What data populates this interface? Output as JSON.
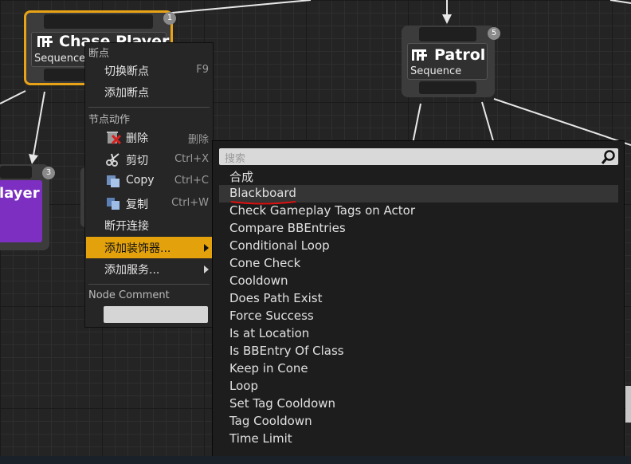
{
  "nodes": {
    "chase_player": {
      "title": "Chase Player",
      "subtitle": "Sequence",
      "index": "1"
    },
    "patrol": {
      "title": "Patrol",
      "subtitle": "Sequence",
      "index": "5"
    },
    "child_node": {
      "title": "layer",
      "index": "3"
    }
  },
  "context_menu": {
    "section_breakpoints": "断点",
    "toggle_breakpoint": {
      "label": "切换断点",
      "shortcut": "F9"
    },
    "add_breakpoint": {
      "label": "添加断点"
    },
    "section_node_actions": "节点动作",
    "delete": {
      "label": "删除",
      "shortcut": "删除",
      "icon": "delete-icon"
    },
    "cut": {
      "label": "剪切",
      "shortcut": "Ctrl+X",
      "icon": "scissors-icon"
    },
    "copy": {
      "label": "Copy",
      "shortcut": "Ctrl+C",
      "icon": "copy-icon"
    },
    "duplicate": {
      "label": "复制",
      "shortcut": "Ctrl+W",
      "icon": "duplicate-icon"
    },
    "break_links": {
      "label": "断开连接"
    },
    "add_decorator": {
      "label": "添加装饰器..."
    },
    "add_service": {
      "label": "添加服务..."
    },
    "section_node_comment": "Node Comment",
    "node_comment_value": ""
  },
  "decorator_submenu": {
    "search_placeholder": "搜索",
    "items": [
      "合成",
      "Blackboard",
      "Check Gameplay Tags on Actor",
      "Compare BBEntries",
      "Conditional Loop",
      "Cone Check",
      "Cooldown",
      "Does Path Exist",
      "Force Success",
      "Is at Location",
      "Is BBEntry Of Class",
      "Keep in Cone",
      "Loop",
      "Set Tag Cooldown",
      "Tag Cooldown",
      "Time Limit"
    ],
    "highlighted_item": "Blackboard"
  },
  "colors": {
    "selection_outline": "#e8a317",
    "menu_highlight": "#e3a20c",
    "purple_node": "#7c2fc0",
    "annotation_underline": "#e01010"
  }
}
